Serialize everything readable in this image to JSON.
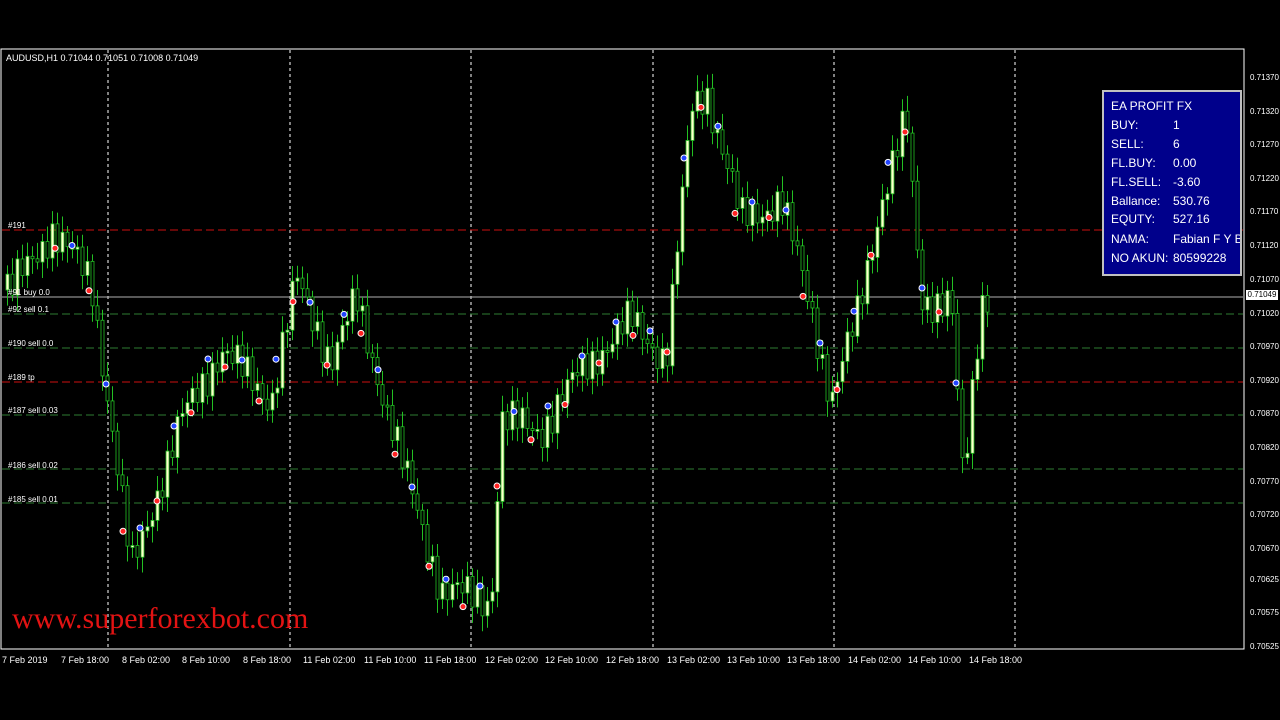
{
  "chart": {
    "symbol_line": "AUDUSD,H1  0.71044 0.71051 0.71008 0.71049",
    "current_price": "0.71049",
    "price_ticks": [
      "0.71370",
      "0.71320",
      "0.71270",
      "0.71220",
      "0.71170",
      "0.71120",
      "0.71070",
      "0.71020",
      "0.70970",
      "0.70920",
      "0.70870",
      "0.70820",
      "0.70770",
      "0.70720",
      "0.70670",
      "0.70625",
      "0.70575",
      "0.70525"
    ],
    "time_ticks": [
      "7 Feb 2019",
      "7 Feb 18:00",
      "8 Feb 02:00",
      "8 Feb 10:00",
      "8 Feb 18:00",
      "11 Feb 02:00",
      "11 Feb 10:00",
      "11 Feb 18:00",
      "12 Feb 02:00",
      "12 Feb 10:00",
      "12 Feb 18:00",
      "13 Feb 02:00",
      "13 Feb 10:00",
      "13 Feb 18:00",
      "14 Feb 02:00",
      "14 Feb 10:00",
      "14 Feb 18:00"
    ],
    "order_labels": [
      "#191",
      "#91 buy 0.0",
      "#92 sell 0.1",
      "#190 sell 0.0",
      "#189 tp",
      "#187 sell 0.03",
      "#186 sell 0.02",
      "#185 sell 0.01"
    ],
    "colors": {
      "bull": "#ffffcc",
      "bear": "#000000",
      "wick": "#22c022",
      "grid": "#ffffff",
      "sell_level": "#2e7d32",
      "tp_level": "#cc1111",
      "buy_marker": "#2244ff",
      "sell_marker": "#ff2222"
    }
  },
  "ea_panel": {
    "title": "EA PROFIT FX",
    "rows": [
      {
        "key": "BUY:",
        "value": "1"
      },
      {
        "key": "SELL:",
        "value": "6"
      },
      {
        "key": "FL.BUY:",
        "value": "0.00"
      },
      {
        "key": "FL.SELL:",
        "value": "-3.60"
      },
      {
        "key": "Ballance:",
        "value": "530.76"
      },
      {
        "key": "EQUTY:",
        "value": "527.16"
      },
      {
        "key": "NAMA:",
        "value": "Fabian F Y B"
      },
      {
        "key": "NO AKUN:",
        "value": "80599228"
      }
    ]
  },
  "watermark": "www.superforexbot.com"
}
